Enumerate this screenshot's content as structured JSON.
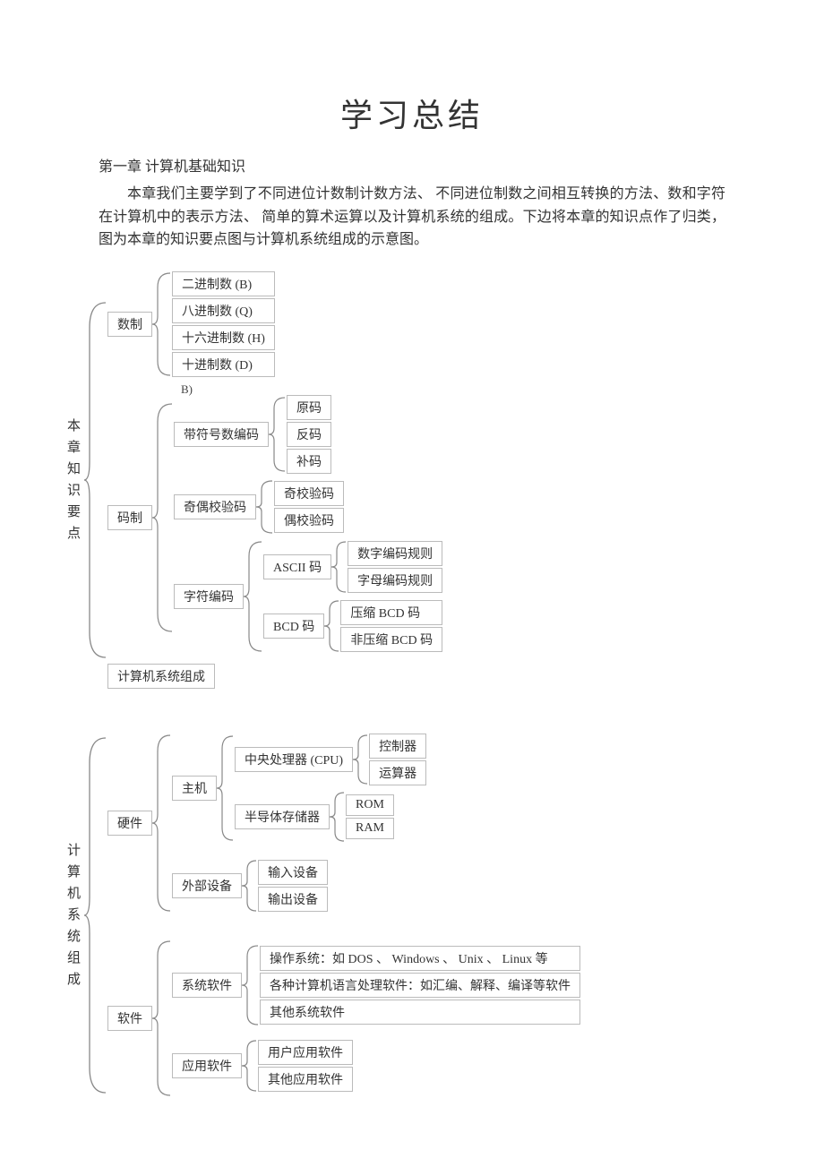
{
  "title": "学习总结",
  "chapter": "第一章   计算机基础知识",
  "paragraph": "本章我们主要学到了不同进位计数制计数方法、 不同进位制数之间相互转换的方法、数和字符在计算机中的表示方法、 简单的算术运算以及计算机系统的组成。下边将本章的知识点作了归类， 图为本章的知识要点图与计算机系统组成的示意图。",
  "tree1": {
    "root": "本\n章\n知\n识\n要\n点",
    "n1": "数制",
    "n1c": [
      "二进制数 (B)",
      "八进制数 (Q)",
      "十六进制数   (H)",
      "十进制数 (D)"
    ],
    "n2": "码制",
    "bnote": "B)",
    "n2a": "带符号数编码",
    "n2a_c": [
      "原码",
      "反码",
      "补码"
    ],
    "n2b": "奇偶校验码",
    "n2b_c": [
      "奇校验码",
      "偶校验码"
    ],
    "n2c": "字符编码",
    "n2c1": "ASCII 码",
    "n2c1_c": [
      "数字编码规则",
      "字母编码规则"
    ],
    "n2c2": "BCD 码",
    "n2c2_c": [
      "压缩 BCD 码",
      "非压缩 BCD 码"
    ],
    "n3": "计算机系统组成"
  },
  "tree2": {
    "root": "计\n算\n机\n系\n统\n组\n成",
    "hw": "硬件",
    "host": "主机",
    "cpu": "中央处理器   (CPU)",
    "cpu_c": [
      "控制器",
      "运算器"
    ],
    "mem": "半导体存储器",
    "mem_c": [
      "ROM",
      "RAM"
    ],
    "ext": "外部设备",
    "ext_c": [
      "输入设备",
      "输出设备"
    ],
    "sw": "软件",
    "sys": "系统软件",
    "sys_c": [
      "操作系统：如    DOS  、 Windows  、 Unix 、 Linux 等",
      "各种计算机语言处理软件：如汇编、解释、编译等软件",
      "其他系统软件"
    ],
    "app": "应用软件",
    "app_c": [
      "用户应用软件",
      "其他应用软件"
    ]
  }
}
